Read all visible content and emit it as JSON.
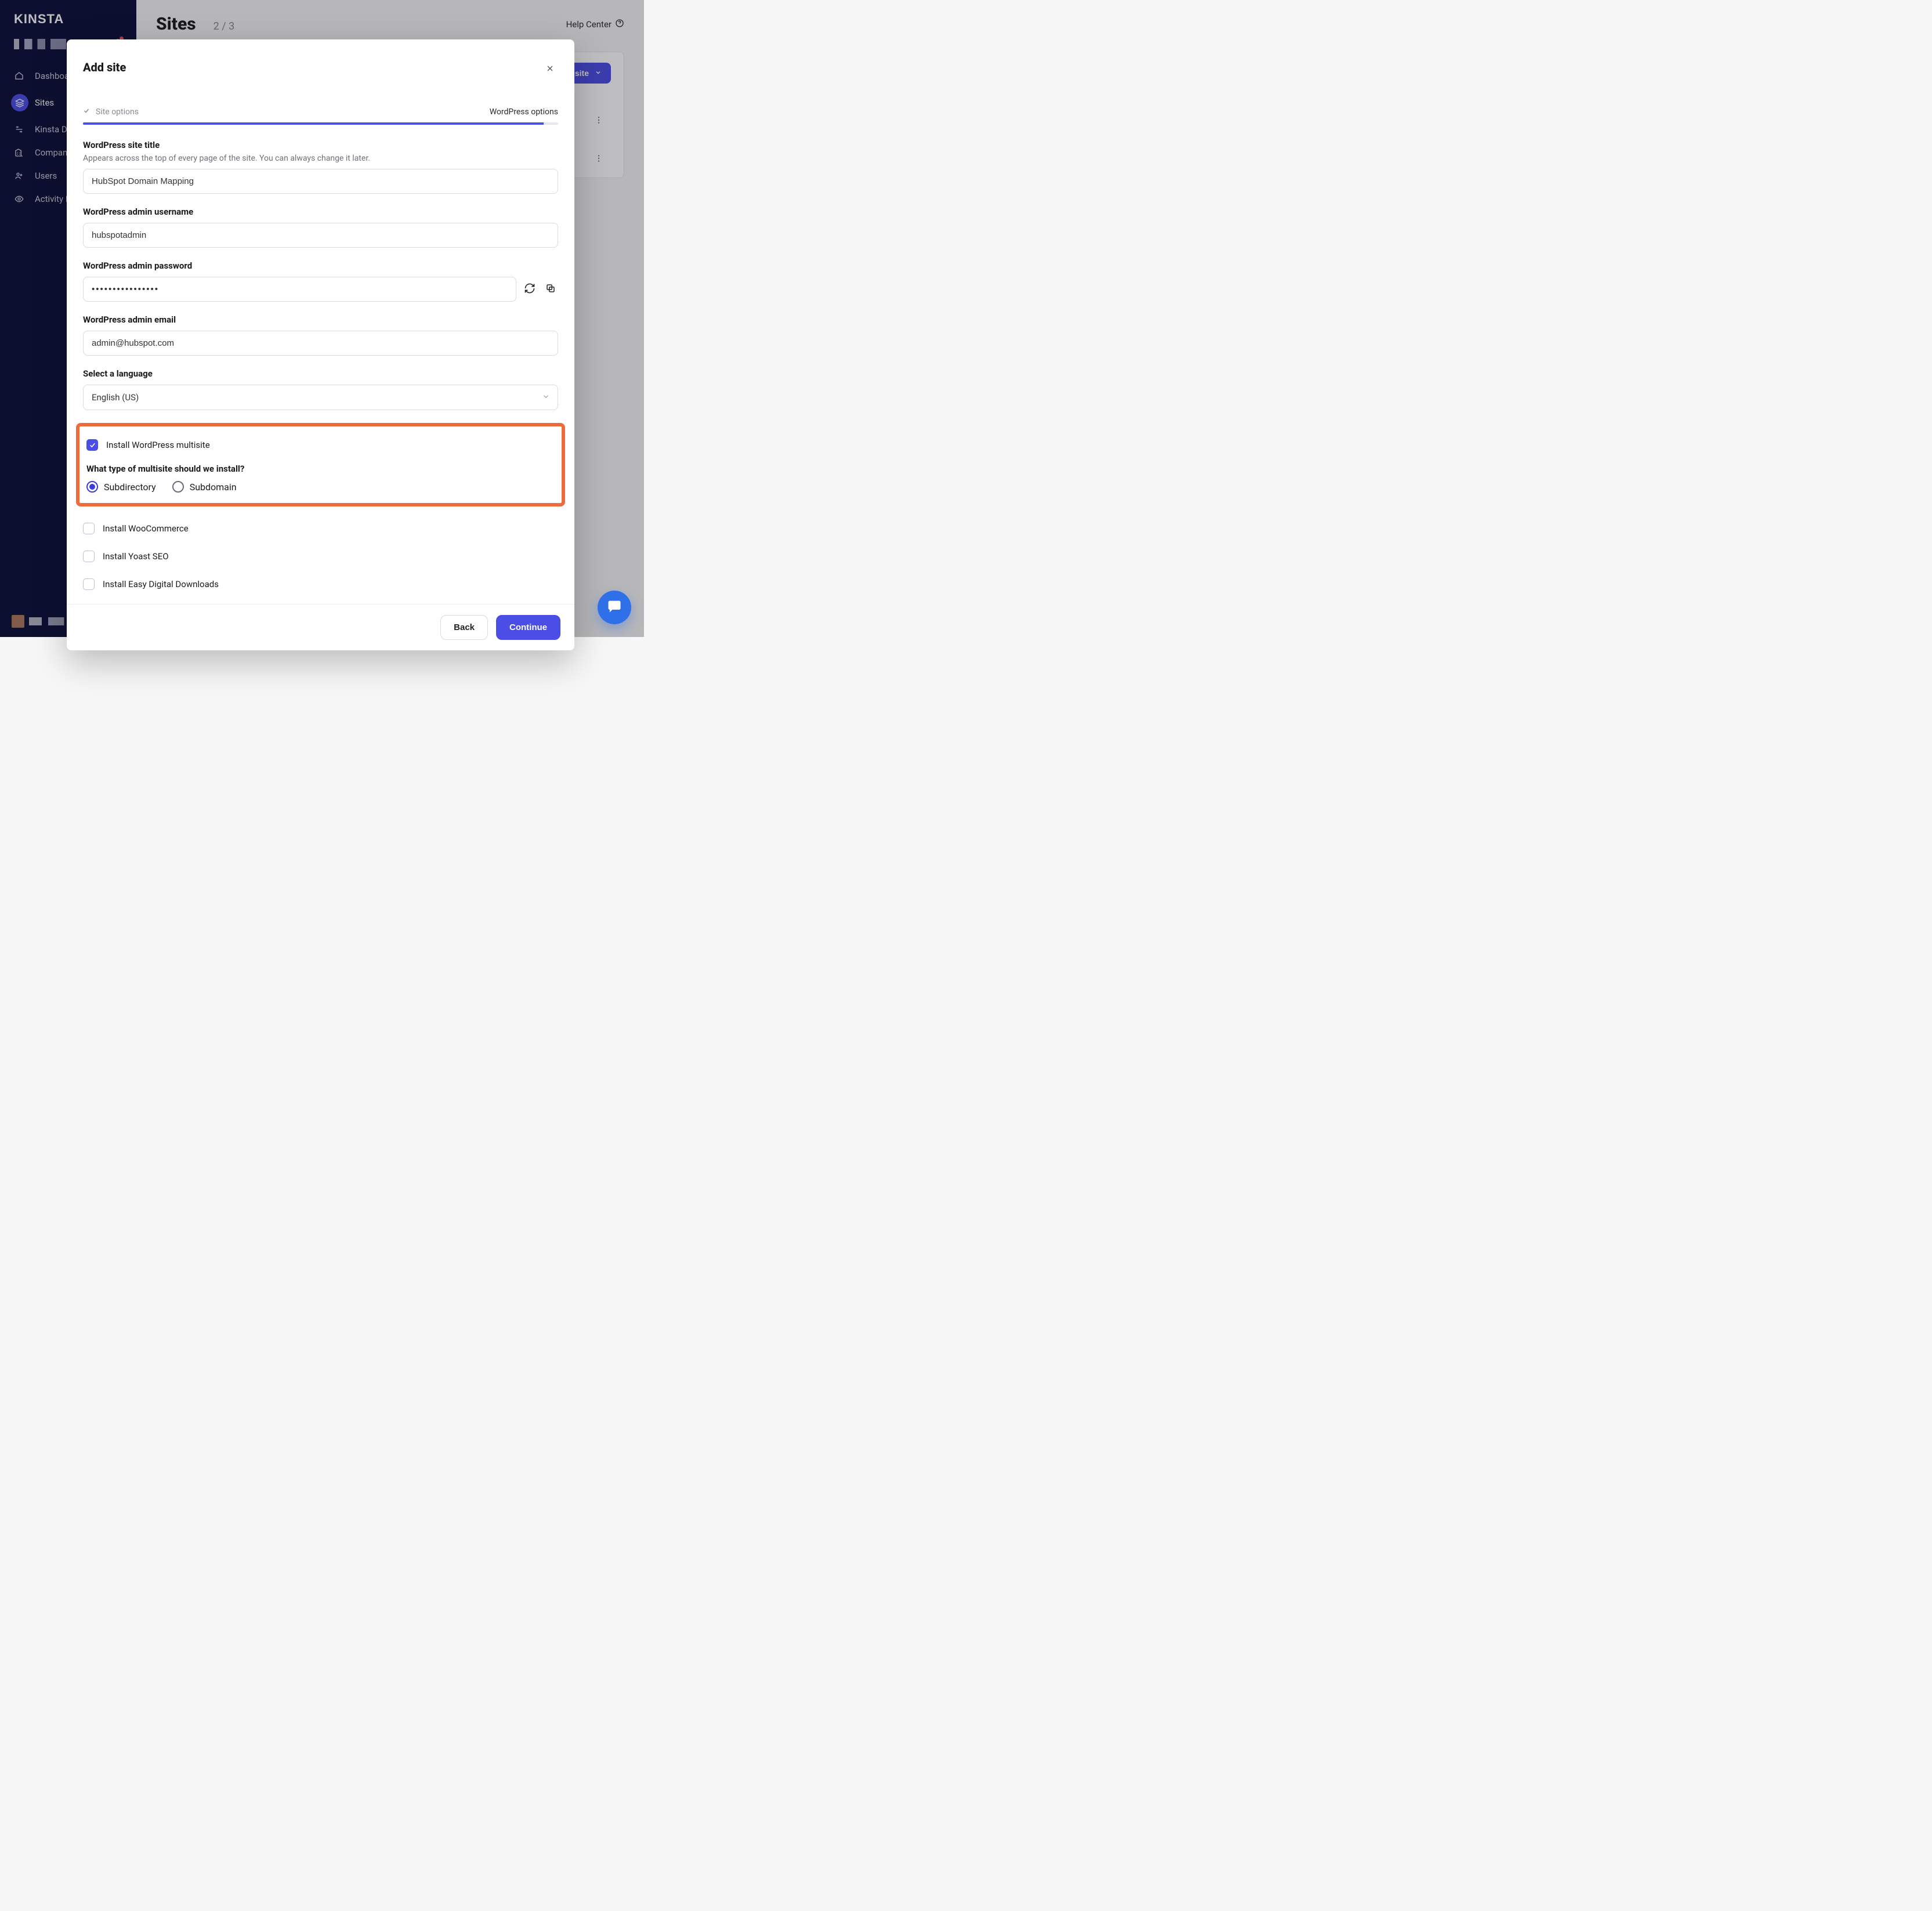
{
  "brand": "KINSTA",
  "sidebar": {
    "items": [
      {
        "label": "Dashboard",
        "icon": "home-icon",
        "active": false
      },
      {
        "label": "Sites",
        "icon": "layers-icon",
        "active": true
      },
      {
        "label": "Kinsta DNS",
        "icon": "dns-icon",
        "active": false
      },
      {
        "label": "Company",
        "icon": "company-icon",
        "active": false
      },
      {
        "label": "Users",
        "icon": "users-icon",
        "active": false
      },
      {
        "label": "Activity Log",
        "icon": "eye-icon",
        "active": false
      }
    ]
  },
  "header": {
    "title": "Sites",
    "count_label": "2 / 3",
    "help_center_label": "Help Center"
  },
  "page": {
    "create_site_label": "Create site"
  },
  "modal": {
    "title": "Add site",
    "step_done_label": "Site options",
    "step_current_label": "WordPress options",
    "progress_pct": 97,
    "fields": {
      "site_title_label": "WordPress site title",
      "site_title_hint": "Appears across the top of every page of the site. You can always change it later.",
      "site_title_value": "HubSpot Domain Mapping",
      "admin_user_label": "WordPress admin username",
      "admin_user_value": "hubspotadmin",
      "admin_pw_label": "WordPress admin password",
      "admin_pw_value": "••••••••••••••••",
      "admin_email_label": "WordPress admin email",
      "admin_email_value": "admin@hubspot.com",
      "language_label": "Select a language",
      "language_value": "English (US)"
    },
    "multisite": {
      "install_label": "Install WordPress multisite",
      "install_checked": true,
      "type_question": "What type of multisite should we install?",
      "option_subdirectory": "Subdirectory",
      "option_subdomain": "Subdomain",
      "selected": "subdirectory"
    },
    "plugins": {
      "woocommerce_label": "Install WooCommerce",
      "yoast_label": "Install Yoast SEO",
      "edd_label": "Install Easy Digital Downloads"
    },
    "footer": {
      "back_label": "Back",
      "continue_label": "Continue"
    }
  }
}
